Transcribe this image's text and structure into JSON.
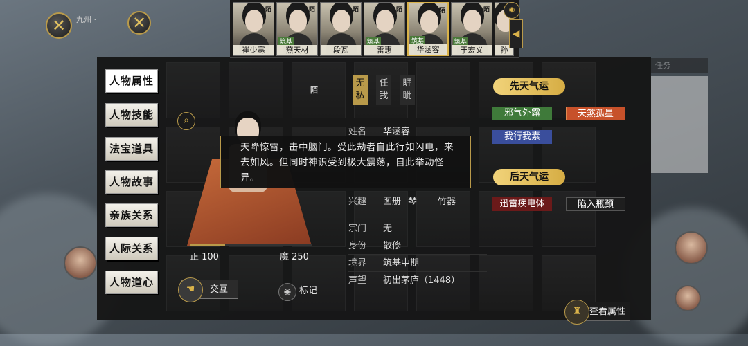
{
  "top_title": "九州 ·",
  "close_icon": "close-icon",
  "portraits": [
    {
      "name": "崔少寒",
      "stamp": "陌",
      "badge": ""
    },
    {
      "name": "燕天材",
      "stamp": "陌",
      "badge": "筑基"
    },
    {
      "name": "段瓦",
      "stamp": "陌",
      "badge": ""
    },
    {
      "name": "雷惠",
      "stamp": "陌",
      "badge": "筑基"
    },
    {
      "name": "华涵容",
      "stamp": "陌",
      "badge": "筑基"
    },
    {
      "name": "于宏义",
      "stamp": "陌",
      "badge": "筑基"
    },
    {
      "name": "孙",
      "stamp": "",
      "badge": ""
    }
  ],
  "selected_portrait": 4,
  "sidebar": {
    "items": [
      {
        "label": "人物属性"
      },
      {
        "label": "人物技能"
      },
      {
        "label": "法宝道具"
      },
      {
        "label": "人物故事"
      },
      {
        "label": "亲族关系"
      },
      {
        "label": "人际关系"
      },
      {
        "label": "人物道心"
      }
    ]
  },
  "character": {
    "seal": "陌",
    "stat_left": "正 100",
    "stat_right": "魔 250",
    "righteous_fraction": 0.29,
    "traits": [
      {
        "label": "无私",
        "active": true
      },
      {
        "label": "任我",
        "active": false
      },
      {
        "label": "睚眦",
        "active": false
      }
    ],
    "info": {
      "name_key": "姓名",
      "name_val": "华涵容",
      "hobby_key": "兴趣",
      "hobbies": [
        "图册",
        "琴",
        "竹器"
      ],
      "sect_key": "宗门",
      "sect_val": "无",
      "status_key": "身份",
      "status_val": "散修",
      "realm_key": "境界",
      "realm_val": "筑基中期",
      "fame_key": "声望",
      "fame_val": "初出茅庐（1448）"
    }
  },
  "tooltip": "天降惊雷，击中脑门。受此劫者自此行如闪电，来去如风。但同时神识受到极大震荡，自此举动怪异。",
  "innate_luck": {
    "title": "先天气运",
    "items": [
      {
        "label": "邪气外露",
        "color": "#3f7a3a"
      },
      {
        "label": "天煞孤星",
        "color": "#c7512a"
      },
      {
        "label": "我行我素",
        "color": "#3a4e9c"
      }
    ]
  },
  "acquired_luck": {
    "title": "后天气运",
    "items": [
      {
        "label": "迅雷疾电体",
        "color": "#6b1a1a"
      },
      {
        "label": "陷入瓶颈",
        "color": "#1e1e1e"
      }
    ]
  },
  "actions": {
    "interact": "交互",
    "mark": "标记",
    "view_detail": "查看属性"
  },
  "right_panel_header": "任务"
}
